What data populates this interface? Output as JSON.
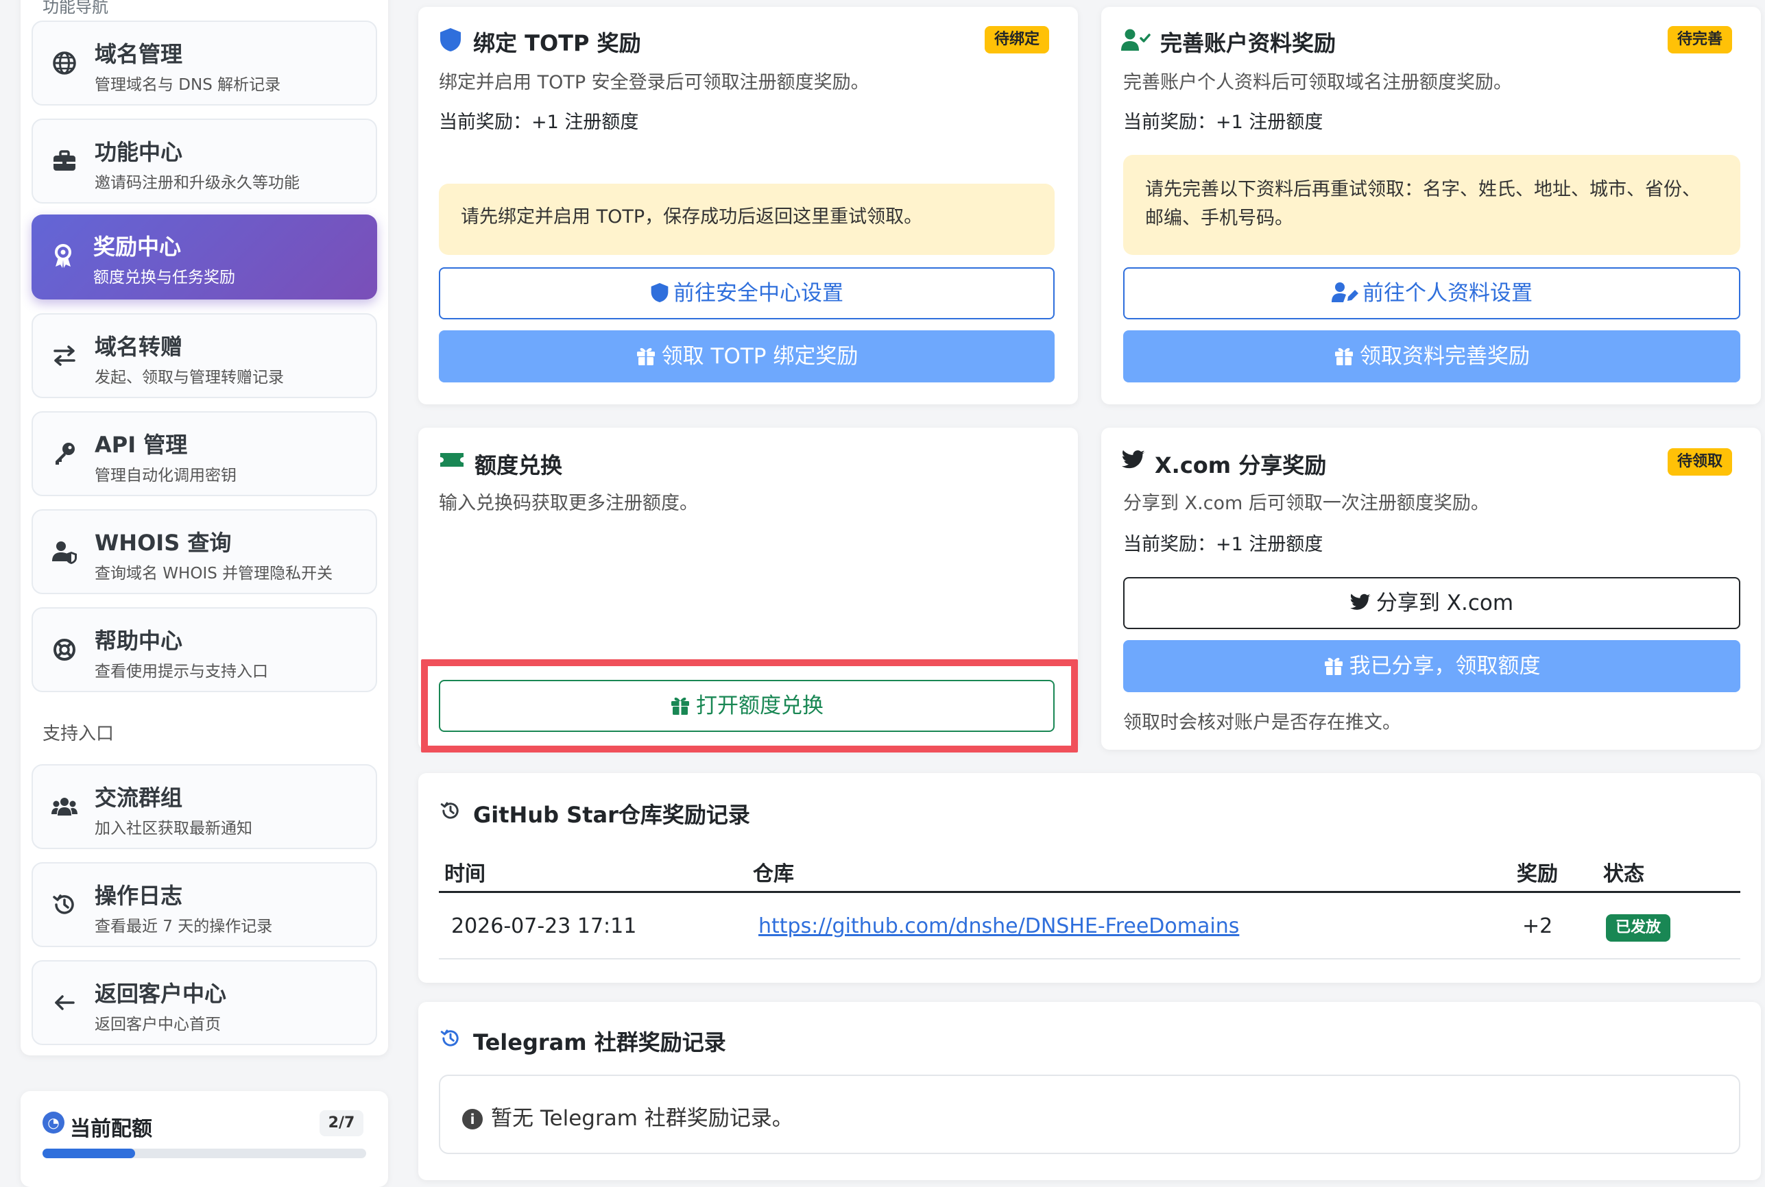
{
  "sidebar": {
    "section_top": "功能导航",
    "items": [
      {
        "title": "域名管理",
        "subtitle": "管理域名与 DNS 解析记录",
        "icon": "globe-icon"
      },
      {
        "title": "功能中心",
        "subtitle": "邀请码注册和升级永久等功能",
        "icon": "toolbox-icon"
      },
      {
        "title": "奖励中心",
        "subtitle": "额度兑换与任务奖励",
        "icon": "award-icon"
      },
      {
        "title": "域名转赠",
        "subtitle": "发起、领取与管理转赠记录",
        "icon": "exchange-icon"
      },
      {
        "title": "API 管理",
        "subtitle": "管理自动化调用密钥",
        "icon": "key-icon"
      },
      {
        "title": "WHOIS 查询",
        "subtitle": "查询域名 WHOIS 并管理隐私开关",
        "icon": "user-shield-icon"
      },
      {
        "title": "帮助中心",
        "subtitle": "查看使用提示与支持入口",
        "icon": "life-ring-icon"
      }
    ],
    "support_label": "支持入口",
    "support_items": [
      {
        "title": "交流群组",
        "subtitle": "加入社区获取最新通知",
        "icon": "users-icon"
      },
      {
        "title": "操作日志",
        "subtitle": "查看最近 7 天的操作记录",
        "icon": "history-icon"
      },
      {
        "title": "返回客户中心",
        "subtitle": "返回客户中心首页",
        "icon": "arrow-left-icon"
      }
    ],
    "quota": {
      "title": "当前配额",
      "value": "2/7",
      "used": 2,
      "total": 7
    }
  },
  "cards": {
    "totp": {
      "title": "绑定 TOTP 奖励",
      "badge": "待绑定",
      "desc": "绑定并启用 TOTP 安全登录后可领取注册额度奖励。",
      "reward": "当前奖励：+1 注册额度",
      "alert": "请先绑定并启用 TOTP，保存成功后返回这里重试领取。",
      "btn_settings": "前往安全中心设置",
      "btn_claim": "领取 TOTP 绑定奖励"
    },
    "profile": {
      "title": "完善账户资料奖励",
      "badge": "待完善",
      "desc": "完善账户个人资料后可领取域名注册额度奖励。",
      "reward": "当前奖励：+1 注册额度",
      "alert": "请先完善以下资料后再重试领取：名字、姓氏、地址、城市、省份、邮编、手机号码。",
      "btn_settings": "前往个人资料设置",
      "btn_claim": "领取资料完善奖励"
    },
    "redeem": {
      "title": "额度兑换",
      "desc": "输入兑换码获取更多注册额度。",
      "btn_open": "打开额度兑换"
    },
    "xshare": {
      "title": "X.com 分享奖励",
      "badge": "待领取",
      "desc": "分享到 X.com 后可领取一次注册额度奖励。",
      "reward": "当前奖励：+1 注册额度",
      "btn_share": "分享到 X.com",
      "btn_claim": "我已分享，领取额度",
      "note": "领取时会核对账户是否存在推文。"
    }
  },
  "github": {
    "title": "GitHub Star仓库奖励记录",
    "headers": [
      "时间",
      "仓库",
      "奖励",
      "状态"
    ],
    "rows": [
      {
        "time": "2026-07-23 17:11",
        "repo": "https://github.com/dnshe/DNSHE-FreeDomains",
        "reward": "+2",
        "status": "已发放"
      }
    ]
  },
  "telegram": {
    "title": "Telegram 社群奖励记录",
    "empty": "暂无 Telegram 社群奖励记录。"
  },
  "colors": {
    "accent": "#2f6fdc",
    "warning": "#ffc107",
    "success": "#198754",
    "highlight": "#f0505a"
  }
}
